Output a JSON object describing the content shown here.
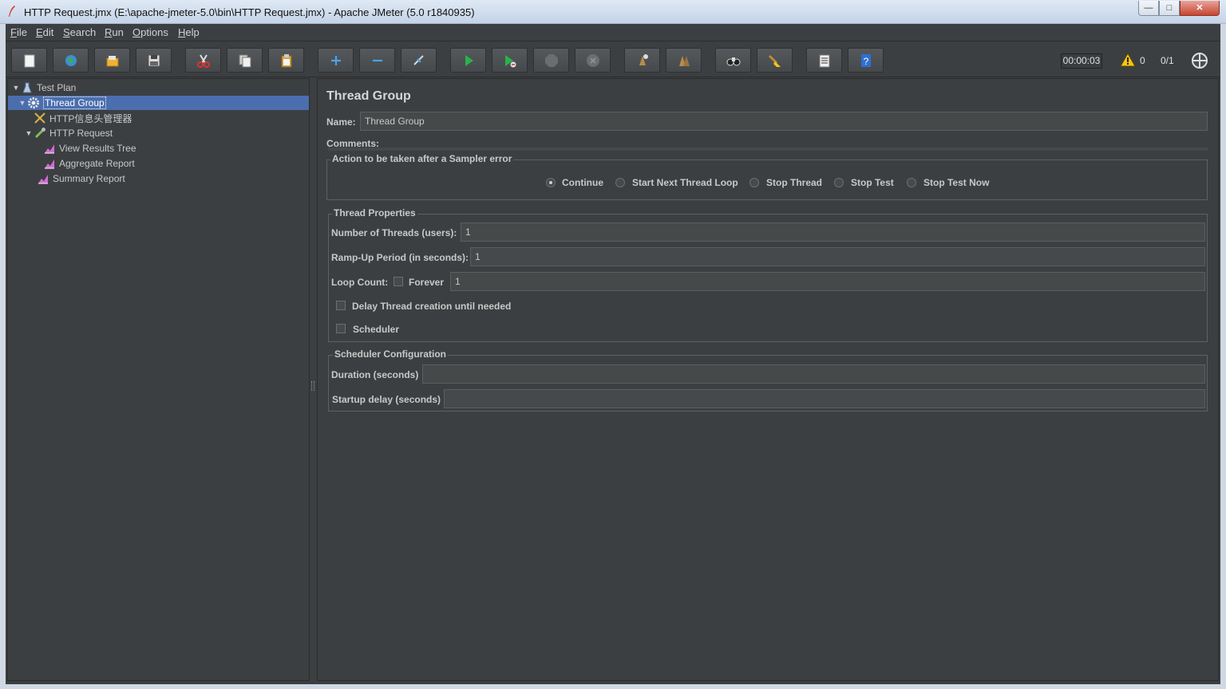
{
  "window": {
    "title": "HTTP Request.jmx (E:\\apache-jmeter-5.0\\bin\\HTTP Request.jmx) - Apache JMeter (5.0 r1840935)",
    "min_glyph": "—",
    "max_glyph": "□",
    "close_glyph": "✕"
  },
  "menu": [
    {
      "mnemonic": "F",
      "rest": "ile"
    },
    {
      "mnemonic": "E",
      "rest": "dit"
    },
    {
      "mnemonic": "S",
      "rest": "earch"
    },
    {
      "mnemonic": "R",
      "rest": "un"
    },
    {
      "mnemonic": "O",
      "rest": "ptions"
    },
    {
      "mnemonic": "H",
      "rest": "elp"
    }
  ],
  "toolbar": {
    "buttons": [
      "new-icon",
      "templates-icon",
      "open-icon",
      "save-icon",
      "cut-icon",
      "copy-icon",
      "paste-icon",
      "expand-icon",
      "collapse-icon",
      "toggle-icon",
      "start-icon",
      "start-no-pause-icon",
      "stop-icon",
      "shutdown-icon",
      "clear-icon",
      "clear-all-icon",
      "search-icon",
      "reset-search-icon",
      "function-helper-icon",
      "help-icon"
    ],
    "timer": "00:00:03",
    "warnings": "0",
    "threads": "0/1"
  },
  "tree": {
    "test_plan": "Test Plan",
    "thread_group": "Thread Group",
    "header_manager": "HTTP信息头管理器",
    "http_request": "HTTP Request",
    "view_results_tree": "View Results Tree",
    "aggregate_report": "Aggregate Report",
    "summary_report": "Summary Report"
  },
  "editor": {
    "title": "Thread Group",
    "name_label": "Name:",
    "name_value": "Thread Group",
    "comments_label": "Comments:",
    "sampler_error": {
      "legend": "Action to be taken after a Sampler error",
      "options": [
        "Continue",
        "Start Next Thread Loop",
        "Stop Thread",
        "Stop Test",
        "Stop Test Now"
      ],
      "selected": "Continue"
    },
    "thread_props": {
      "legend": "Thread Properties",
      "threads_label": "Number of Threads (users):",
      "threads_value": "1",
      "rampup_label": "Ramp-Up Period (in seconds):",
      "rampup_value": "1",
      "loop_label": "Loop Count:",
      "forever_label": "Forever",
      "loop_value": "1",
      "delay_label": "Delay Thread creation until needed",
      "scheduler_label": "Scheduler"
    },
    "scheduler_config": {
      "legend": "Scheduler Configuration",
      "duration_label": "Duration (seconds)",
      "duration_value": "",
      "startup_label": "Startup delay (seconds)",
      "startup_value": ""
    }
  },
  "colors": {
    "panel_bg": "#3c3f41",
    "selection": "#4b6eaf",
    "text": "#c8c8c8"
  }
}
